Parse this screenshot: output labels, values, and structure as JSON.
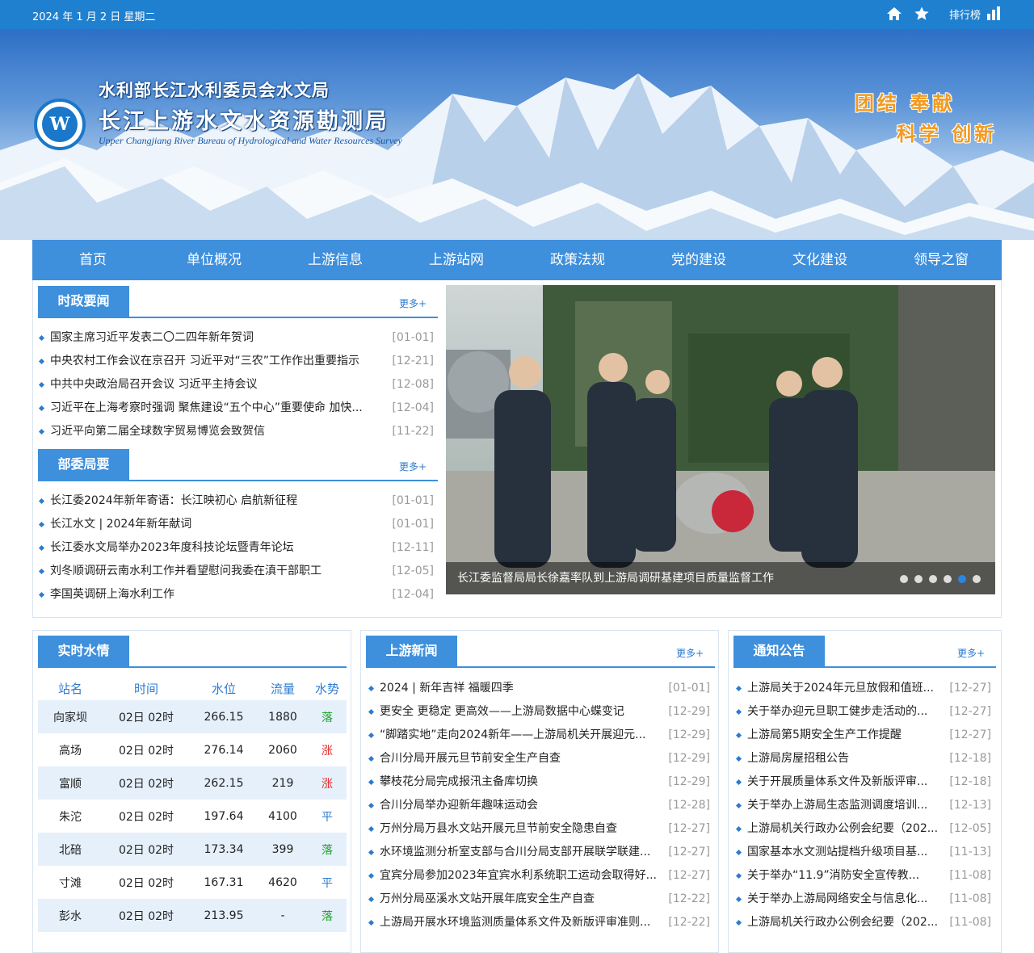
{
  "topbar": {
    "date": "2024 年 1 月 2 日   星期二",
    "home_icon": "home-icon",
    "favorite_icon": "star-icon",
    "rank_label": "排行榜",
    "rank_icon": "bar-chart-icon"
  },
  "header": {
    "org_parent": "水利部长江水利委员会水文局",
    "org_name": "长江上游水文水资源勘测局",
    "org_name_en": "Upper Changjiang River Bureau of Hydrological and Water Resources Survey",
    "logo_letter": "W",
    "motto_line1": "团结  奉献",
    "motto_line2": "科学  创新"
  },
  "nav": {
    "items": [
      "首页",
      "单位概况",
      "上游信息",
      "上游站网",
      "政策法规",
      "党的建设",
      "文化建设",
      "领导之窗"
    ]
  },
  "politics": {
    "title": "时政要闻",
    "more": "更多+",
    "items": [
      {
        "title": "国家主席习近平发表二〇二四年新年贺词",
        "date": "[01-01]"
      },
      {
        "title": "中央农村工作会议在京召开 习近平对“三农”工作作出重要指示",
        "date": "[12-21]"
      },
      {
        "title": "中共中央政治局召开会议 习近平主持会议",
        "date": "[12-08]"
      },
      {
        "title": "习近平在上海考察时强调 聚焦建设“五个中心”重要使命 加快...",
        "date": "[12-04]"
      },
      {
        "title": "习近平向第二届全球数字贸易博览会致贺信",
        "date": "[11-22]"
      }
    ]
  },
  "ministry": {
    "title": "部委局要闻",
    "more": "更多+",
    "items": [
      {
        "title": "长江委2024年新年寄语：长江映初心 启航新征程",
        "date": "[01-01]"
      },
      {
        "title": "长江水文 | 2024年新年献词",
        "date": "[01-01]"
      },
      {
        "title": "长江委水文局举办2023年度科技论坛暨青年论坛",
        "date": "[12-11]"
      },
      {
        "title": "刘冬顺调研云南水利工作并看望慰问我委在滇干部职工",
        "date": "[12-05]"
      },
      {
        "title": "李国英调研上海水利工作",
        "date": "[12-04]"
      }
    ]
  },
  "slideshow": {
    "caption": "长江委监督局局长徐嘉率队到上游局调研基建项目质量监督工作",
    "slide_count": 6,
    "active_index": 4
  },
  "water": {
    "title": "实时水情",
    "headers": [
      "站名",
      "时间",
      "水位",
      "流量",
      "水势"
    ],
    "rows": [
      {
        "station": "向家坝",
        "time": "02日 02时",
        "level": "266.15",
        "flow": "1880",
        "trend": "落"
      },
      {
        "station": "高场",
        "time": "02日 02时",
        "level": "276.14",
        "flow": "2060",
        "trend": "涨"
      },
      {
        "station": "富顺",
        "time": "02日 02时",
        "level": "262.15",
        "flow": "219",
        "trend": "涨"
      },
      {
        "station": "朱沱",
        "time": "02日 02时",
        "level": "197.64",
        "flow": "4100",
        "trend": "平"
      },
      {
        "station": "北碚",
        "time": "02日 02时",
        "level": "173.34",
        "flow": "399",
        "trend": "落"
      },
      {
        "station": "寸滩",
        "time": "02日 02时",
        "level": "167.31",
        "flow": "4620",
        "trend": "平"
      },
      {
        "station": "彭水",
        "time": "02日 02时",
        "level": "213.95",
        "flow": "-",
        "trend": "落"
      }
    ],
    "trend_colors": {
      "涨": "#e62b2b",
      "落": "#22a52a",
      "平": "#2c7bd0"
    }
  },
  "upnews": {
    "title": "上游新闻",
    "more": "更多+",
    "items": [
      {
        "title": "2024 | 新年吉祥 福暖四季",
        "date": "[01-01]"
      },
      {
        "title": "更安全 更稳定 更高效——上游局数据中心蝶变记",
        "date": "[12-29]"
      },
      {
        "title": "“脚踏实地”走向2024新年——上游局机关开展迎元...",
        "date": "[12-29]"
      },
      {
        "title": "合川分局开展元旦节前安全生产自查",
        "date": "[12-29]"
      },
      {
        "title": "攀枝花分局完成报汛主备库切换",
        "date": "[12-29]"
      },
      {
        "title": "合川分局举办迎新年趣味运动会",
        "date": "[12-28]"
      },
      {
        "title": "万州分局万县水文站开展元旦节前安全隐患自查",
        "date": "[12-27]"
      },
      {
        "title": "水环境监测分析室支部与合川分局支部开展联学联建...",
        "date": "[12-27]"
      },
      {
        "title": "宜宾分局参加2023年宜宾水利系统职工运动会取得好...",
        "date": "[12-27]"
      },
      {
        "title": "万州分局巫溪水文站开展年底安全生产自查",
        "date": "[12-22]"
      },
      {
        "title": "上游局开展水环境监测质量体系文件及新版评审准则...",
        "date": "[12-22]"
      }
    ]
  },
  "notices": {
    "title": "通知公告",
    "more": "更多+",
    "items": [
      {
        "title": "上游局关于2024年元旦放假和值班...",
        "date": "[12-27]"
      },
      {
        "title": "关于举办迎元旦职工健步走活动的...",
        "date": "[12-27]"
      },
      {
        "title": "上游局第5期安全生产工作提醒",
        "date": "[12-27]"
      },
      {
        "title": "上游局房屋招租公告",
        "date": "[12-18]"
      },
      {
        "title": "关于开展质量体系文件及新版评审...",
        "date": "[12-18]"
      },
      {
        "title": "关于举办上游局生态监测调度培训...",
        "date": "[12-13]"
      },
      {
        "title": "上游局机关行政办公例会纪要（202...",
        "date": "[12-05]"
      },
      {
        "title": "国家基本水文测站提档升级项目基...",
        "date": "[11-13]"
      },
      {
        "title": "关于举办“11.9”消防安全宣传教...",
        "date": "[11-08]"
      },
      {
        "title": "关于举办上游局网络安全与信息化...",
        "date": "[11-08]"
      },
      {
        "title": "上游局机关行政办公例会纪要（202...",
        "date": "[11-08]"
      }
    ]
  },
  "colors": {
    "brand": "#1f80d0",
    "nav": "#3e8fdc",
    "motto": "#f39a1e"
  }
}
